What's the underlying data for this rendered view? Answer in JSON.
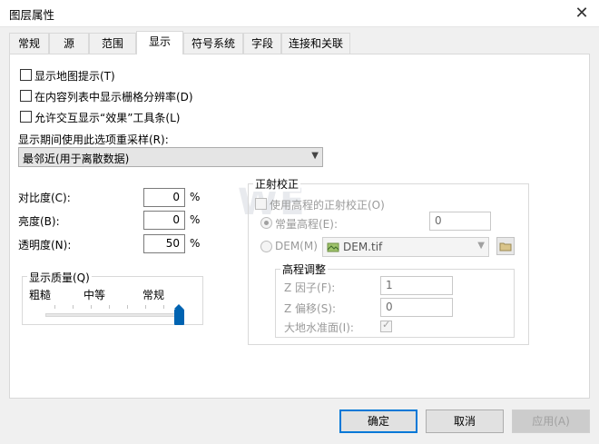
{
  "window": {
    "title": "图层属性",
    "close_glyph": "✕"
  },
  "tabs": [
    {
      "label": "常规"
    },
    {
      "label": "源"
    },
    {
      "label": "范围"
    },
    {
      "label": "显示"
    },
    {
      "label": "符号系统"
    },
    {
      "label": "字段"
    },
    {
      "label": "连接和关联"
    }
  ],
  "active_tab": "显示",
  "options": {
    "show_map_tips": {
      "label": "显示地图提示(T)",
      "checked": false
    },
    "show_raster_resolution": {
      "label": "在内容列表中显示栅格分辨率(D)",
      "checked": false
    },
    "allow_effects_toolbar": {
      "label": "允许交互显示“效果”工具条(L)",
      "checked": false
    }
  },
  "resample": {
    "label": "显示期间使用此选项重采样(R):",
    "selected": "最邻近(用于离散数据)"
  },
  "adjust": {
    "contrast": {
      "label": "对比度(C):",
      "value": "0",
      "unit": "%"
    },
    "brightness": {
      "label": "亮度(B):",
      "value": "0",
      "unit": "%"
    },
    "transparency": {
      "label": "透明度(N):",
      "value": "50",
      "unit": "%"
    }
  },
  "quality": {
    "title": "显示质量(Q)",
    "labels": [
      "粗糙",
      "中等",
      "常规"
    ],
    "value": "常规"
  },
  "ortho": {
    "title": "正射校正",
    "use_elevation": {
      "label": "使用高程的正射校正(O)",
      "checked": false
    },
    "constant": {
      "label": "常量高程(E):",
      "value": "0",
      "selected": true
    },
    "dem": {
      "label": "DEM(M)",
      "selected_file": "DEM.tif"
    },
    "elev_adjust": {
      "title": "高程调整",
      "z_factor": {
        "label": "Z 因子(F):",
        "value": "1"
      },
      "z_offset": {
        "label": "Z 偏移(S):",
        "value": "0"
      },
      "geoid": {
        "label": "大地水准面(I):",
        "checked": true
      }
    }
  },
  "buttons": {
    "ok": "确定",
    "cancel": "取消",
    "apply": "应用(A)"
  },
  "icons": {
    "dem_icon": "raster-dataset-icon",
    "folder_icon": "open-folder-icon",
    "dropdown": "▼"
  }
}
